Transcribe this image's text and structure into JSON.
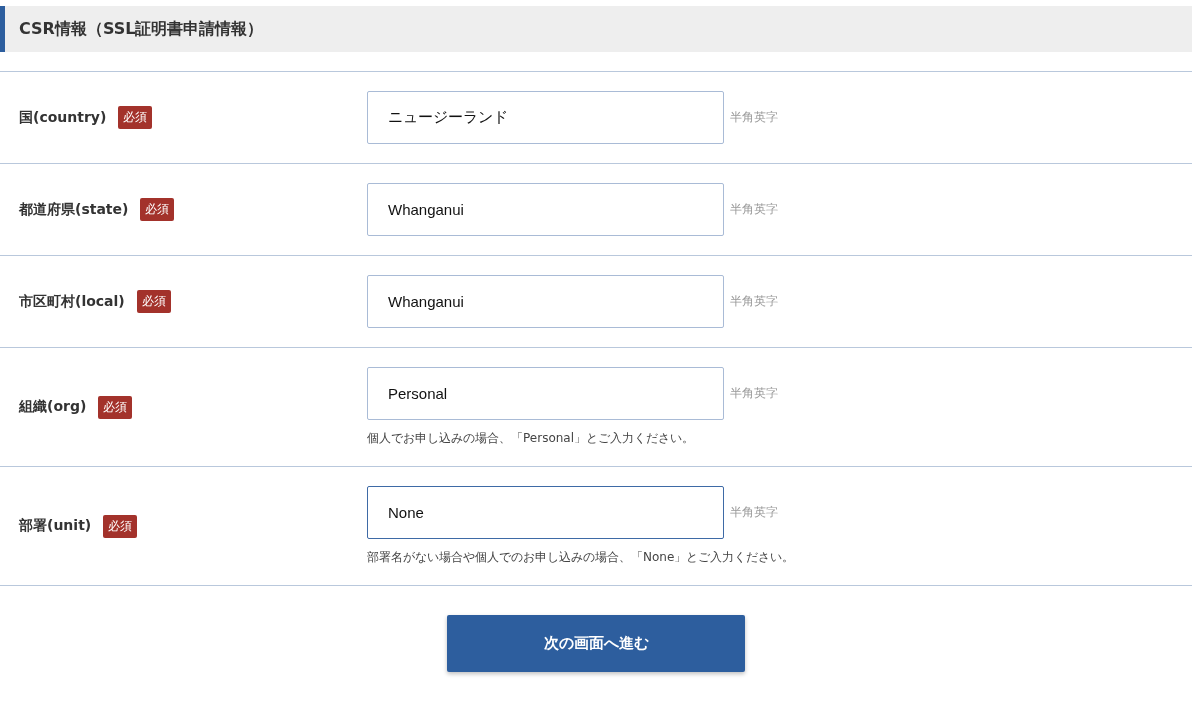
{
  "section": {
    "title": "CSR情報（SSL証明書申請情報）"
  },
  "fields": [
    {
      "label": "国(country)",
      "badge": "必須",
      "value": "ニュージーランド",
      "hint": "半角英字",
      "focused": false
    },
    {
      "label": "都道府県(state)",
      "badge": "必須",
      "value": "Whanganui",
      "hint": "半角英字",
      "focused": false
    },
    {
      "label": "市区町村(local)",
      "badge": "必須",
      "value": "Whanganui",
      "hint": "半角英字",
      "focused": false
    },
    {
      "label": "組織(org)",
      "badge": "必須",
      "value": "Personal",
      "hint": "半角英字",
      "note": "個人でお申し込みの場合、「Personal」とご入力ください。",
      "focused": false
    },
    {
      "label": "部署(unit)",
      "badge": "必須",
      "value": "None",
      "hint": "半角英字",
      "note": "部署名がない場合や個人でのお申し込みの場合、「None」とご入力ください。",
      "focused": true
    }
  ],
  "submit": {
    "label": "次の画面へ進む"
  }
}
